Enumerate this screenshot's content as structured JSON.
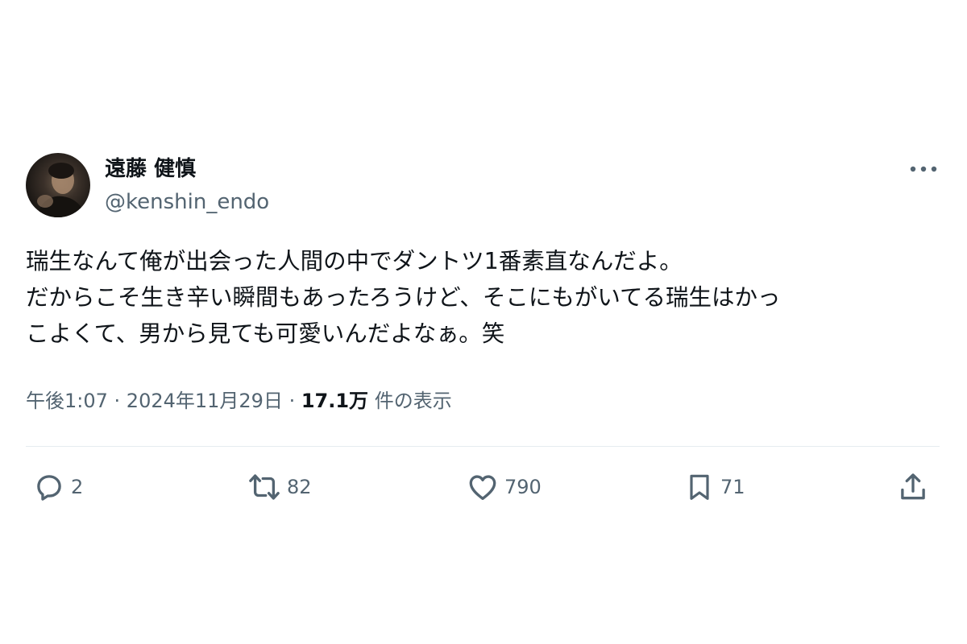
{
  "author": {
    "display_name": "遠藤 健慎",
    "handle": "@kenshin_endo",
    "avatar_icon": "profile-photo"
  },
  "tweet": {
    "lines": [
      "瑞生なんて俺が出会った人間の中でダントツ1番素直なんだよ。",
      "だからこそ生き辛い瞬間もあったろうけど、そこにもがいてる瑞生はかっ",
      "こよくて、男から見ても可愛いんだよなぁ。笑"
    ]
  },
  "meta": {
    "time": "午後1:07",
    "separator": " · ",
    "date": "2024年11月29日",
    "views_count": "17.1万",
    "views_label": " 件の表示"
  },
  "actions": {
    "reply": {
      "icon": "reply-icon",
      "count": "2"
    },
    "retweet": {
      "icon": "retweet-icon",
      "count": "82"
    },
    "like": {
      "icon": "heart-icon",
      "count": "790"
    },
    "bookmark": {
      "icon": "bookmark-icon",
      "count": "71"
    },
    "share": {
      "icon": "share-icon"
    }
  },
  "colors": {
    "text_primary": "#0f1419",
    "text_secondary": "#536471",
    "divider": "#e6ecf0",
    "background": "#ffffff"
  }
}
